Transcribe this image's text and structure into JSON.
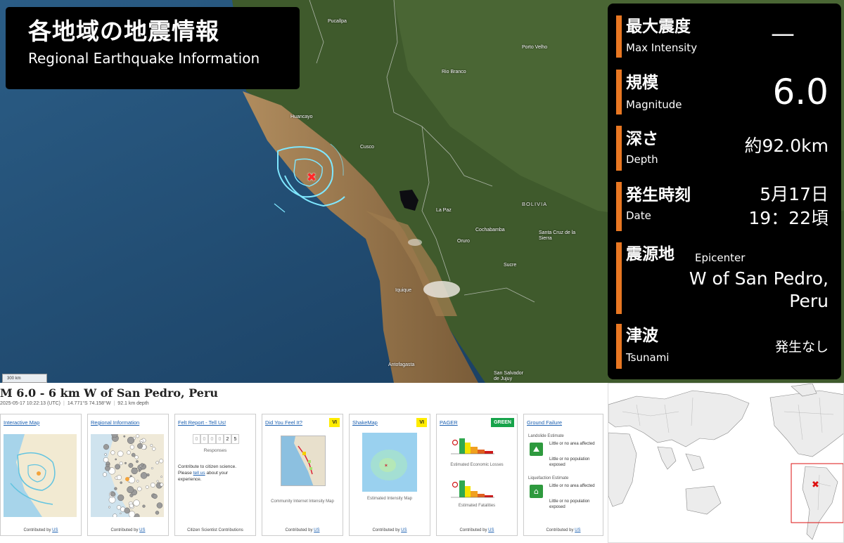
{
  "title": {
    "jp": "各地域の地震情報",
    "en": "Regional Earthquake Information"
  },
  "info": {
    "max_intensity": {
      "jp": "最大震度",
      "en": "Max Intensity",
      "value": "—"
    },
    "magnitude": {
      "jp": "規模",
      "en": "Magnitude",
      "value": "6.0"
    },
    "depth": {
      "jp": "深さ",
      "en": "Depth",
      "value": "約92.0km"
    },
    "date": {
      "jp": "発生時刻",
      "en": "Date",
      "value_date": "5月17日",
      "value_time": "19：22頃"
    },
    "epicenter": {
      "jp": "震源地",
      "en": "Epicenter",
      "value_line1": "W of San Pedro,",
      "value_line2": "Peru"
    },
    "tsunami": {
      "jp": "津波",
      "en": "Tsunami",
      "value": "発生なし"
    }
  },
  "map": {
    "cities": [
      {
        "name": "Pucallpa"
      },
      {
        "name": "Porto Velho"
      },
      {
        "name": "Rio Branco"
      },
      {
        "name": "Huancayo"
      },
      {
        "name": "Cusco"
      },
      {
        "name": "La Paz"
      },
      {
        "name": "Cochabamba"
      },
      {
        "name": "Oruro"
      },
      {
        "name": "Santa Cruz de la Sierra"
      },
      {
        "name": "Sucre"
      },
      {
        "name": "Iquique"
      },
      {
        "name": "Antofagasta"
      },
      {
        "name": "San Salvador de Jujuy"
      }
    ],
    "country": "BOLIVIA",
    "scale": "300 km"
  },
  "usgs": {
    "event_title": "M 6.0 - 6 km W of San Pedro, Peru",
    "time": "2025-05-17 10:22:13 (UTC)",
    "location": "14.771°S 74.158°W",
    "depth": "92.1 km depth",
    "cards": {
      "interactive_map": {
        "title": "Interactive Map",
        "contrib": "Contributed by",
        "contrib_link": "US"
      },
      "regional": {
        "title": "Regional Information",
        "contrib": "Contributed by",
        "contrib_link": "US"
      },
      "felt": {
        "title": "Felt Report - Tell Us!",
        "digits": [
          "0",
          "0",
          "0",
          "0",
          "2",
          "5"
        ],
        "responses": "Responses",
        "text1": "Contribute to citizen science. Please ",
        "text_link": "tell us",
        "text2": " about your experience.",
        "contrib": "Citizen Scientist Contributions"
      },
      "dyfi": {
        "title": "Did You Feel It?",
        "badge": "VI",
        "caption": "Community Internet Intensity Map",
        "contrib": "Contributed by",
        "contrib_link": "US"
      },
      "shakemap": {
        "title": "ShakeMap",
        "badge": "VI",
        "caption": "Estimated Intensity Map",
        "contrib": "Contributed by",
        "contrib_link": "US"
      },
      "pager": {
        "title": "PAGER",
        "badge": "GREEN",
        "losses": "Estimated Economic Losses",
        "fatalities": "Estimated Fatalities",
        "contrib": "Contributed by",
        "contrib_link": "US"
      },
      "ground": {
        "title": "Ground Failure",
        "landslide": "Landslide Estimate",
        "ls_area": "Little or no area affected",
        "ls_pop": "Little or no population exposed",
        "liquefaction": "Liquefaction Estimate",
        "lq_area": "Little or no area affected",
        "lq_pop": "Little or no population exposed",
        "contrib": "Contributed by",
        "contrib_link": "US"
      }
    }
  },
  "colors": {
    "accent": "#e87722",
    "panel": "#000000",
    "link": "#1a5fb0",
    "badge_vi": "#ffec00",
    "badge_green": "#16a34a",
    "epicenter": "#ff2a2a"
  }
}
